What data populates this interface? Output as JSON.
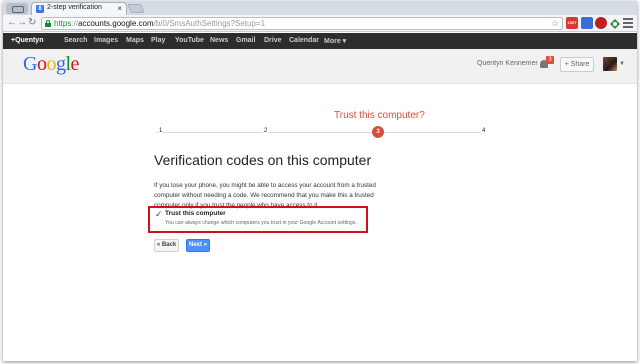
{
  "browser": {
    "tab_title": "2-step verification",
    "tab_favicon": "8",
    "url_scheme": "https",
    "url_sep": "://",
    "url_host": "accounts.google.com",
    "url_path": "/b/0/SmsAuthSettings?Setup=1",
    "gmail_badge": "1597"
  },
  "google_bar": {
    "items": [
      "+Quentyn",
      "Search",
      "Images",
      "Maps",
      "Play",
      "YouTube",
      "News",
      "Gmail",
      "Drive",
      "Calendar",
      "More ▾"
    ]
  },
  "header": {
    "logo_letters": [
      {
        "ch": "G",
        "color": "#3369e8"
      },
      {
        "ch": "o",
        "color": "#d50f25"
      },
      {
        "ch": "o",
        "color": "#eeb211"
      },
      {
        "ch": "g",
        "color": "#3369e8"
      },
      {
        "ch": "l",
        "color": "#009925"
      },
      {
        "ch": "e",
        "color": "#d50f25"
      }
    ],
    "user_name": "Quentyn Kennemer",
    "notification_count": "3",
    "share_label": "+ Share"
  },
  "stepper": {
    "current_title": "Trust this computer?",
    "steps": [
      "1",
      "2",
      "3",
      "4"
    ],
    "current_step": "3"
  },
  "main": {
    "title": "Verification codes on this computer",
    "description": "If you lose your phone, you might be able to access your account from a trusted computer without needing a code. We recommend that you make this a trusted computer only if you trust the people who have access to it.",
    "trust_checkbox_label": "Trust this computer",
    "trust_checkbox_sub": "You can always change which computers you trust in your Google Account settings.",
    "trust_checked": true,
    "back_label": "« Back",
    "next_label": "Next »"
  }
}
